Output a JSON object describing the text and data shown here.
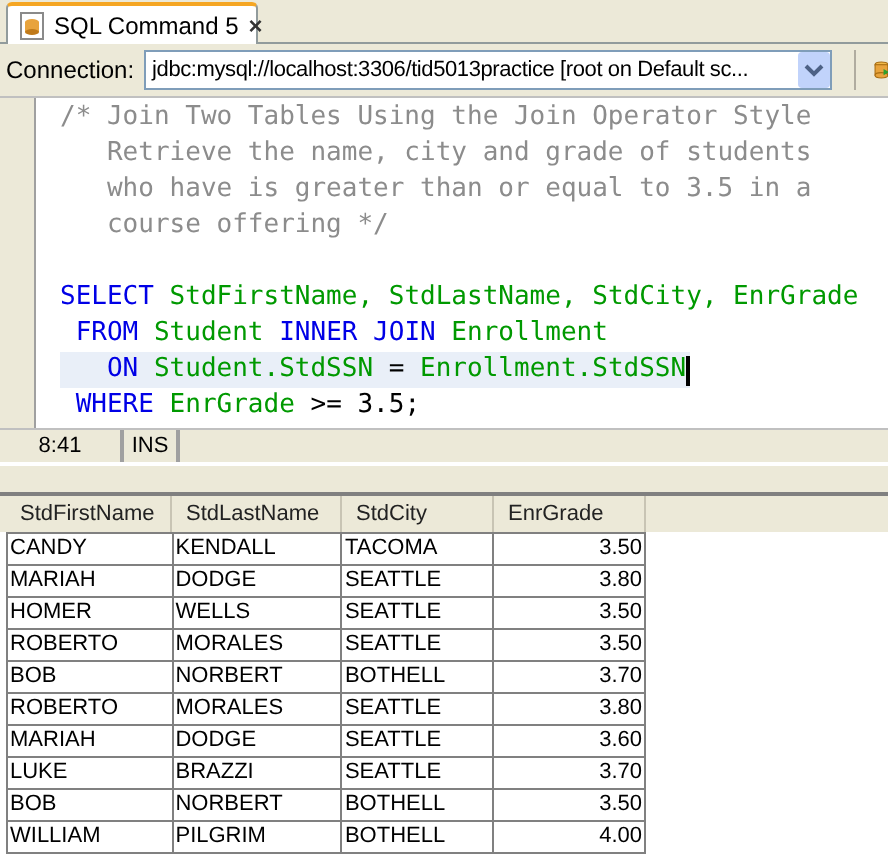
{
  "tab": {
    "title": "SQL Command 5",
    "close": "×"
  },
  "toolbar": {
    "label": "Connection:",
    "connection": "jdbc:mysql://localhost:3306/tid5013practice [root on Default sc..."
  },
  "editor": {
    "comment_lines": [
      {
        "current": false,
        "tokens": [
          {
            "kind": "comment",
            "text": "/* Join Two Tables Using the Join Operator Style"
          }
        ]
      },
      {
        "current": false,
        "tokens": [
          {
            "kind": "comment",
            "text": "   Retrieve the name, city and grade of students"
          }
        ]
      },
      {
        "current": false,
        "tokens": [
          {
            "kind": "comment",
            "text": "   who have is greater than or equal to 3.5 in a"
          }
        ]
      },
      {
        "current": false,
        "tokens": [
          {
            "kind": "comment",
            "text": "   course offering */"
          }
        ]
      }
    ],
    "query_lines": [
      {
        "current": false,
        "tokens": [
          {
            "kind": "keyword",
            "text": "SELECT"
          },
          {
            "kind": "ident",
            "text": " StdFirstName, StdLastName, StdCity, EnrGrade"
          }
        ]
      },
      {
        "current": false,
        "tokens": [
          {
            "kind": "keyword",
            "text": " FROM"
          },
          {
            "kind": "ident",
            "text": " Student"
          },
          {
            "kind": "keyword",
            "text": " INNER JOIN"
          },
          {
            "kind": "ident",
            "text": " Enrollment"
          }
        ]
      },
      {
        "current": true,
        "tokens": [
          {
            "kind": "keyword",
            "text": "   ON"
          },
          {
            "kind": "ident",
            "text": " Student.StdSSN"
          },
          {
            "kind": "plain",
            "text": " = "
          },
          {
            "kind": "ident",
            "text": "Enrollment.StdSSN"
          }
        ]
      },
      {
        "current": false,
        "tokens": [
          {
            "kind": "keyword",
            "text": " WHERE"
          },
          {
            "kind": "ident",
            "text": " EnrGrade"
          },
          {
            "kind": "plain",
            "text": " >= 3.5;"
          }
        ]
      }
    ]
  },
  "status_bar": {
    "position": "8:41",
    "mode": "INS"
  },
  "table": {
    "columns": [
      "StdFirstName",
      "StdLastName",
      "StdCity",
      "EnrGrade"
    ],
    "rows": [
      [
        "CANDY",
        "KENDALL",
        "TACOMA",
        "3.50"
      ],
      [
        "MARIAH",
        "DODGE",
        "SEATTLE",
        "3.80"
      ],
      [
        "HOMER",
        "WELLS",
        "SEATTLE",
        "3.50"
      ],
      [
        "ROBERTO",
        "MORALES",
        "SEATTLE",
        "3.50"
      ],
      [
        "BOB",
        "NORBERT",
        "BOTHELL",
        "3.70"
      ],
      [
        "ROBERTO",
        "MORALES",
        "SEATTLE",
        "3.80"
      ],
      [
        "MARIAH",
        "DODGE",
        "SEATTLE",
        "3.60"
      ],
      [
        "LUKE",
        "BRAZZI",
        "SEATTLE",
        "3.70"
      ],
      [
        "BOB",
        "NORBERT",
        "BOTHELL",
        "3.50"
      ],
      [
        "WILLIAM",
        "PILGRIM",
        "BOTHELL",
        "4.00"
      ]
    ]
  }
}
